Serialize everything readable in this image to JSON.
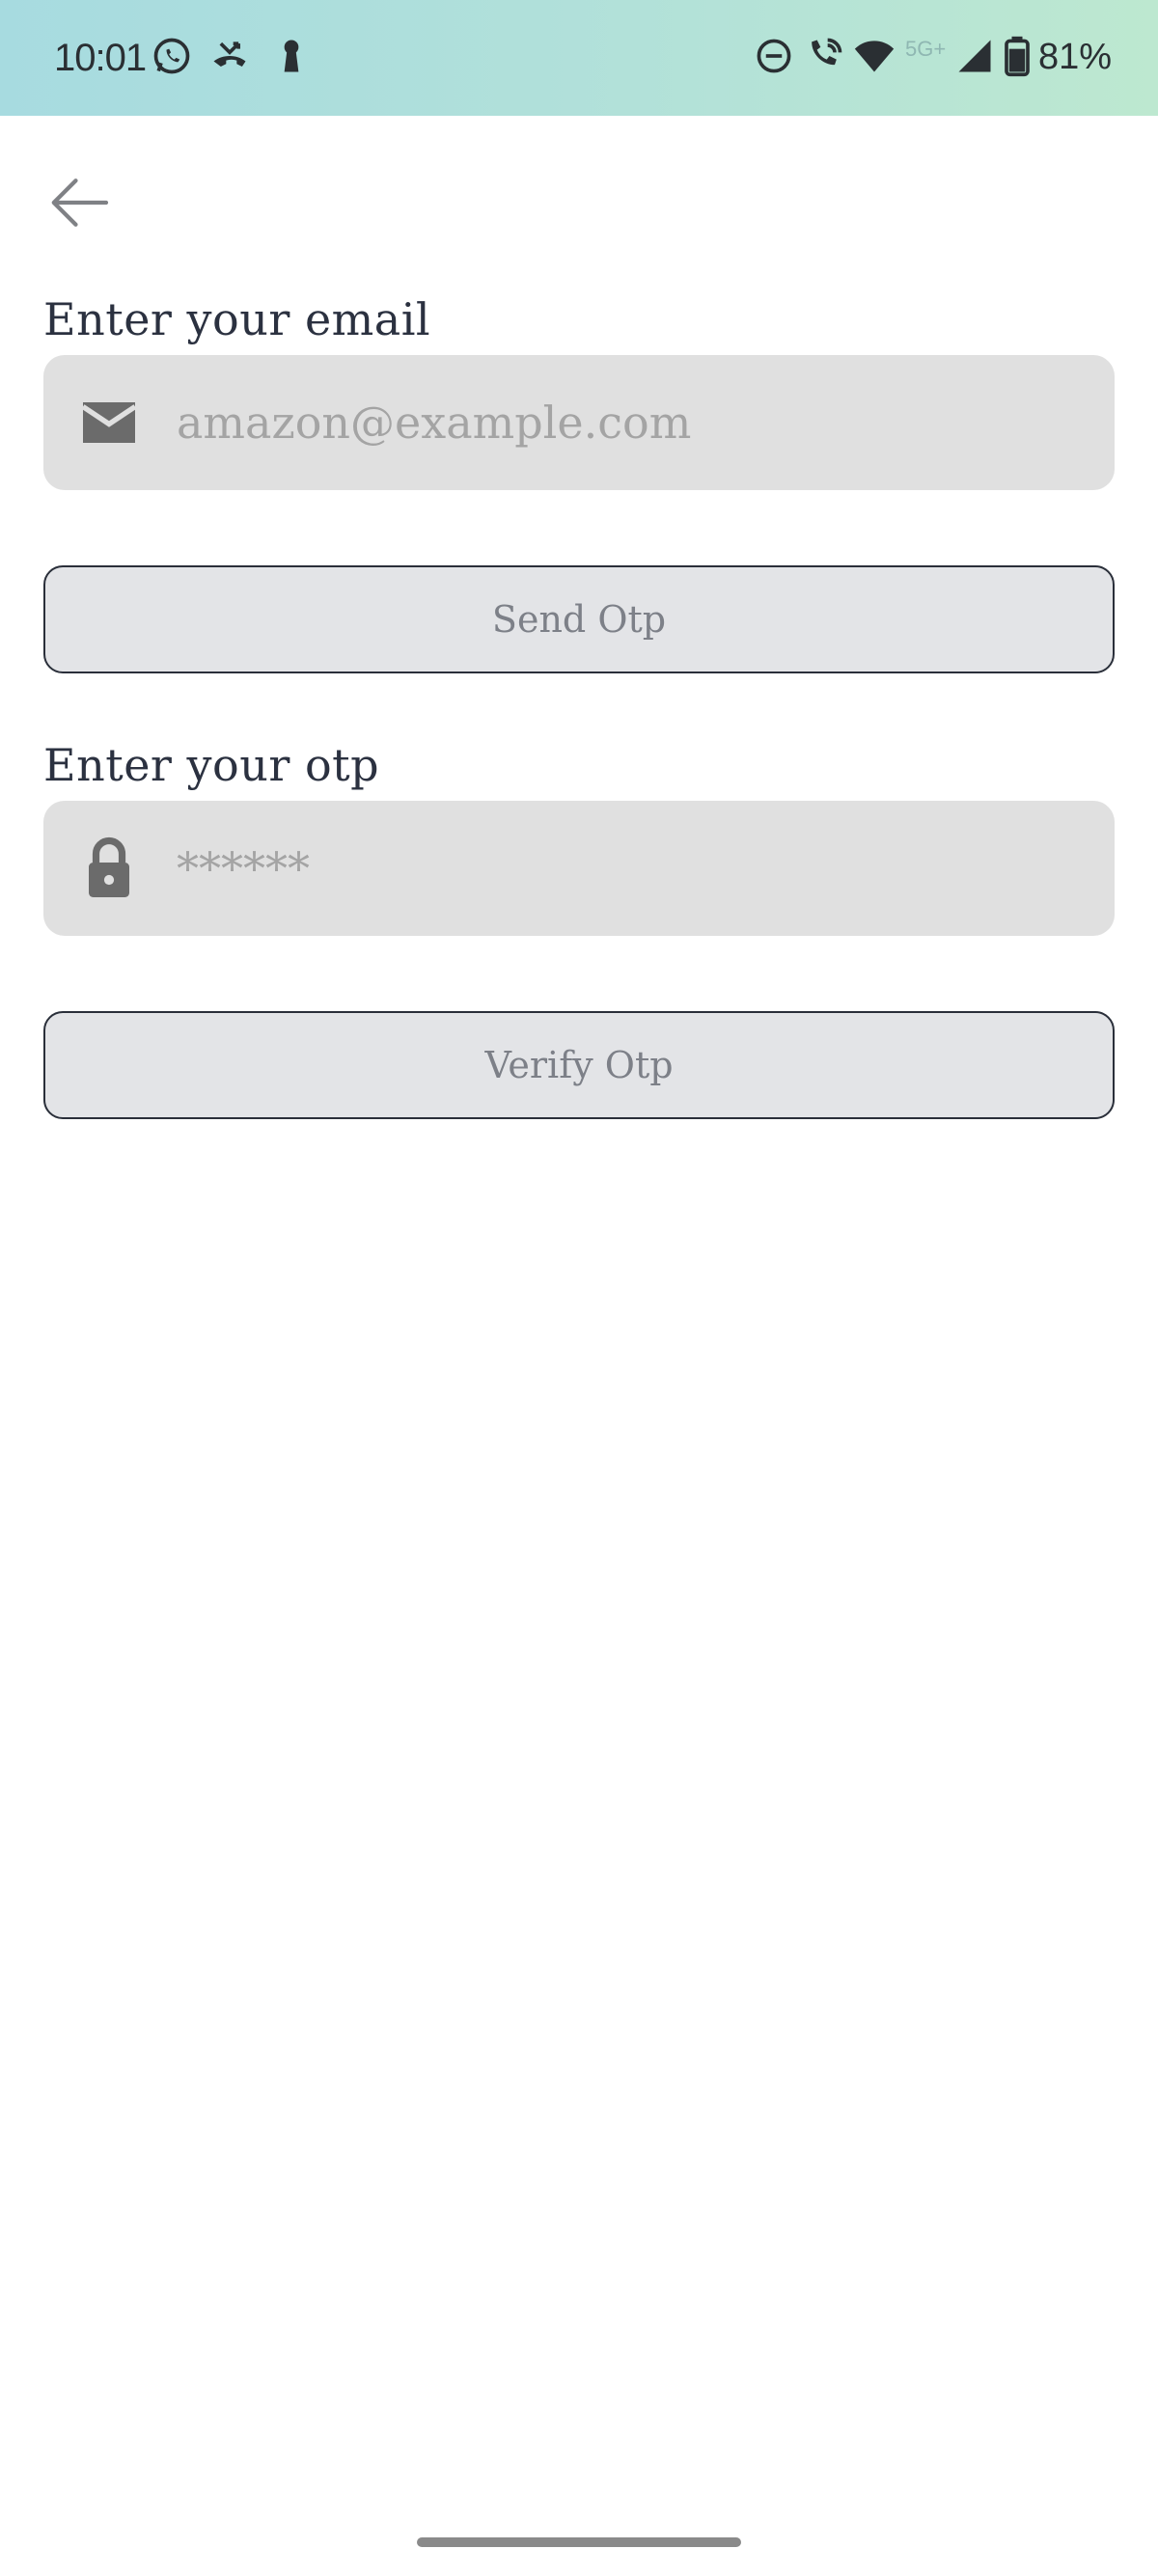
{
  "status_bar": {
    "time": "10:01",
    "network_type": "5G+",
    "battery": "81%",
    "background_colors": [
      "#a7dbe0",
      "#bde8d0"
    ]
  },
  "icons": {
    "back": "arrow-left-icon",
    "email": "envelope-icon",
    "otp": "lock-icon"
  },
  "email_section": {
    "label": "Enter your email",
    "placeholder": "amazon@example.com",
    "value": ""
  },
  "send_button": {
    "label": "Send Otp"
  },
  "otp_section": {
    "label": "Enter your otp",
    "placeholder": "******",
    "value": ""
  },
  "verify_button": {
    "label": "Verify Otp"
  },
  "colors": {
    "input_background": "#e0e0e0",
    "button_background": "#e3e4e7",
    "button_text": "#7d8088",
    "label_text": "#2b3140",
    "icon": "#6b6b6b"
  }
}
